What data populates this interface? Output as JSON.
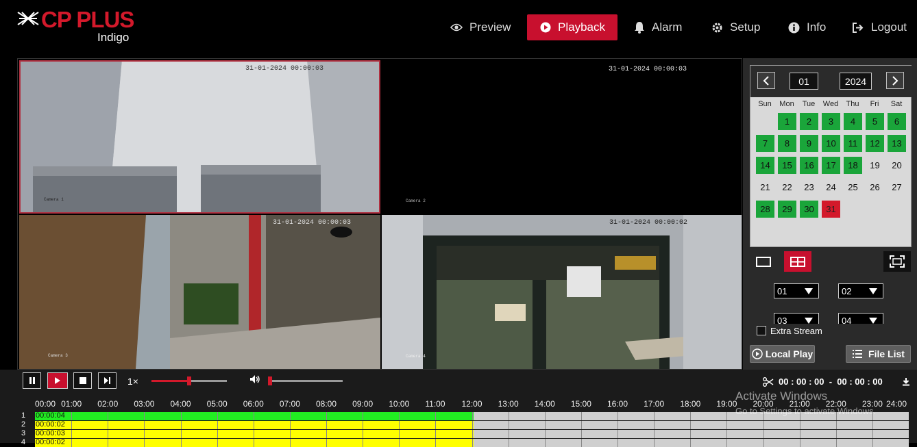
{
  "brand": {
    "name": "CP PLUS",
    "sub": "Indigo"
  },
  "nav": [
    {
      "label": "Preview",
      "icon": "eye-icon"
    },
    {
      "label": "Playback",
      "icon": "play-circle-icon",
      "active": true
    },
    {
      "label": "Alarm",
      "icon": "bell-icon"
    },
    {
      "label": "Setup",
      "icon": "gear-icon"
    },
    {
      "label": "Info",
      "icon": "info-icon"
    },
    {
      "label": "Logout",
      "icon": "logout-icon"
    }
  ],
  "cameras": [
    {
      "timestamp": "31-01-2024 00:00:03",
      "label": "Camera 1"
    },
    {
      "timestamp": "31-01-2024 00:00:03",
      "label": "Camera 2"
    },
    {
      "timestamp": "31-01-2024 00:00:03",
      "label": "Camera 3"
    },
    {
      "timestamp": "31-01-2024 00:00:02",
      "label": "Camera 4"
    }
  ],
  "calendar": {
    "month": "01",
    "year": "2024",
    "weekdays": [
      "Sun",
      "Mon",
      "Tue",
      "Wed",
      "Thu",
      "Fri",
      "Sat"
    ],
    "days": [
      "1",
      "2",
      "3",
      "4",
      "5",
      "6",
      "7",
      "8",
      "9",
      "10",
      "11",
      "12",
      "13",
      "14",
      "15",
      "16",
      "17",
      "18",
      "19",
      "20",
      "21",
      "22",
      "23",
      "24",
      "25",
      "26",
      "27",
      "28",
      "29",
      "30",
      "31"
    ],
    "recorded_days": [
      1,
      2,
      3,
      4,
      5,
      6,
      7,
      8,
      9,
      10,
      11,
      12,
      13,
      14,
      15,
      16,
      17,
      18,
      28,
      29,
      30
    ],
    "selected_day": 31,
    "first_weekday": 1,
    "colors": {
      "recorded": "#1aa53a",
      "selected": "#d3192b"
    }
  },
  "channels": {
    "opt1": "01",
    "opt2": "02",
    "opt3": "03",
    "opt4": "04"
  },
  "extra_stream": "Extra Stream",
  "buttons": {
    "local_play": "Local Play",
    "file_list": "File List"
  },
  "playback": {
    "speed": "1×",
    "progress": 0.5,
    "volume": 0.0
  },
  "clip_range": "00 : 00 : 00  -  00 : 00 : 00",
  "timeline": {
    "ticks": [
      "00:00",
      "01:00",
      "02:00",
      "03:00",
      "04:00",
      "05:00",
      "06:00",
      "07:00",
      "08:00",
      "09:00",
      "10:00",
      "11:00",
      "12:00",
      "13:00",
      "14:00",
      "15:00",
      "16:00",
      "17:00",
      "18:00",
      "19:00",
      "20:00",
      "21:00",
      "22:00",
      "23:00",
      "24:00"
    ],
    "rows": [
      {
        "label": "1",
        "time": "00:00:04",
        "color": "#22ee22",
        "end_hour": 12.05
      },
      {
        "label": "2",
        "time": "00:00:02",
        "color": "#ffff00",
        "end_hour": 12.05
      },
      {
        "label": "3",
        "time": "00:00:03",
        "color": "#ffff00",
        "end_hour": 12.05
      },
      {
        "label": "4",
        "time": "00:00:02",
        "color": "#ffff00",
        "end_hour": 12.05
      }
    ]
  },
  "watermark": {
    "line1": "Activate Windows",
    "line2": "Go to Settings to activate Windows."
  }
}
